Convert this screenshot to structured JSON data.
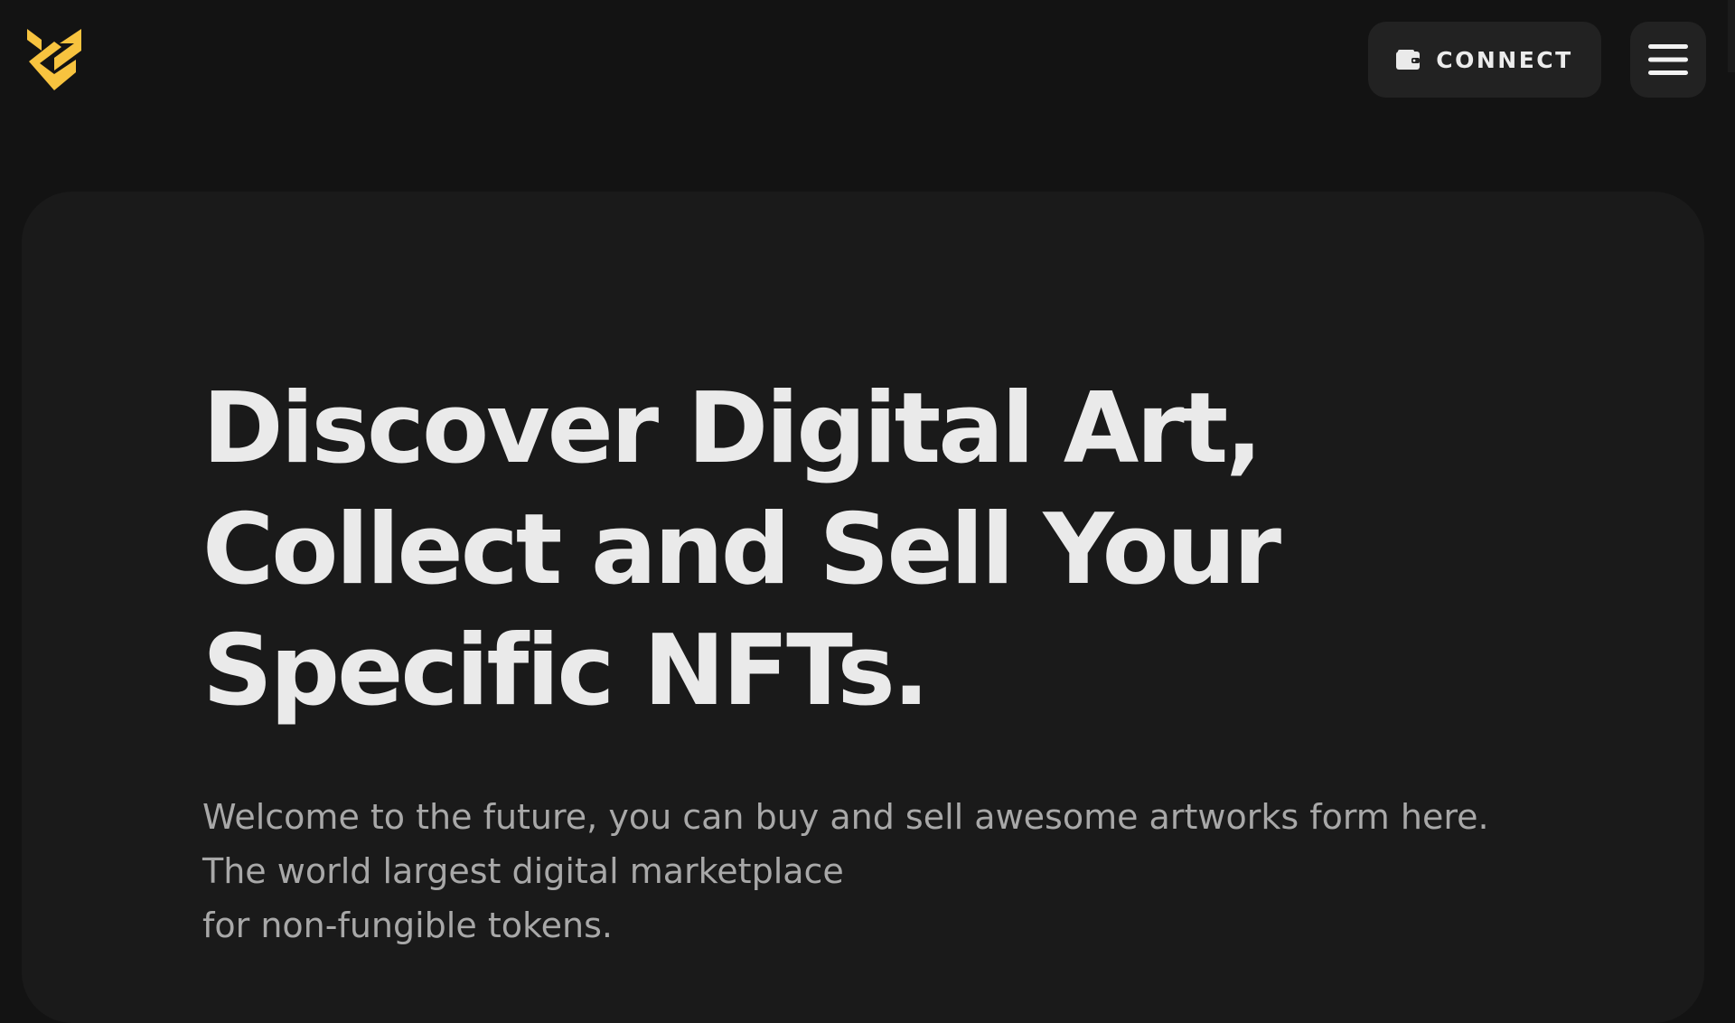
{
  "brand": {
    "logo_icon": "brand-logo-icon",
    "accent_color": "#F7C33F"
  },
  "header": {
    "connect_label": "CONNECT",
    "connect_icon": "wallet-icon",
    "menu_icon": "hamburger-menu-icon"
  },
  "hero": {
    "title": "Discover Digital Art,\nCollect and Sell Your\nSpecific NFTs.",
    "description": "Welcome to the future, you can buy and sell awesome artworks form here.\nThe world largest digital marketplace\nfor non-fungible tokens."
  },
  "colors": {
    "page_background": "#131313",
    "card_background": "#1a1a1a",
    "button_background": "#222222",
    "title_text": "#eaeaea",
    "body_text": "#a8a8a8"
  }
}
